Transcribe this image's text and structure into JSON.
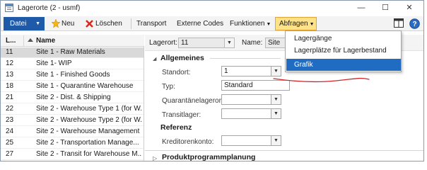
{
  "window": {
    "title": "Lagerorte (2 - usmf)",
    "controls": {
      "minimize": "—",
      "maximize": "☐",
      "close": "✕"
    }
  },
  "action_pane": {
    "datei": "Datei",
    "new": "Neu",
    "delete": "Löschen",
    "transport": "Transport",
    "external_codes": "Externe Codes",
    "functions": "Funktionen",
    "queries": "Abfragen",
    "accent_color": "#1f5aa8",
    "highlight_color": "#fde28a"
  },
  "list": {
    "columns": [
      "L...",
      "Name"
    ],
    "rows": [
      {
        "id": "11",
        "name": "Site 1 - Raw Materials",
        "selected": true
      },
      {
        "id": "12",
        "name": "Site 1- WIP"
      },
      {
        "id": "13",
        "name": "Site 1 - Finished Goods"
      },
      {
        "id": "18",
        "name": "Site 1 - Quarantine Warehouse"
      },
      {
        "id": "21",
        "name": "Site 2 - Dist. & Shipping"
      },
      {
        "id": "22",
        "name": "Site 2 - Warehouse Type 1 (for W..."
      },
      {
        "id": "23",
        "name": "Site 2 - Warehouse Type 2 (for W..."
      },
      {
        "id": "24",
        "name": "Site 2 - Warehouse Management"
      },
      {
        "id": "25",
        "name": "Site 2 - Transportation Manage..."
      },
      {
        "id": "27",
        "name": "Site 2 - Transit for Warehouse M..."
      }
    ]
  },
  "detail": {
    "lagerort_label": "Lagerort:",
    "lagerort_value": "11",
    "name_label": "Name:",
    "name_value": "Site",
    "group_allgemeines": "Allgemeines",
    "standort_label": "Standort:",
    "standort_value": "1",
    "typ_label": "Typ:",
    "typ_value": "Standard",
    "quarantaene_label": "Quarantänelagerort:",
    "quarantaene_value": "",
    "transitlager_label": "Transitlager:",
    "transitlager_value": "",
    "group_referenz": "Referenz",
    "kreditoren_label": "Kreditorenkonto:",
    "kreditoren_value": "",
    "section_produktprogramm": "Produktprogrammplanung"
  },
  "menu": {
    "items": [
      {
        "label": "Lagergänge"
      },
      {
        "label": "Lagerplätze für Lagerbestand"
      },
      {
        "label": "Grafik",
        "highlighted": true
      }
    ]
  },
  "icons": [
    "app-icon",
    "new-star-icon",
    "delete-x-icon",
    "layout-icon",
    "help-icon",
    "dropdown-arrow-icon"
  ]
}
